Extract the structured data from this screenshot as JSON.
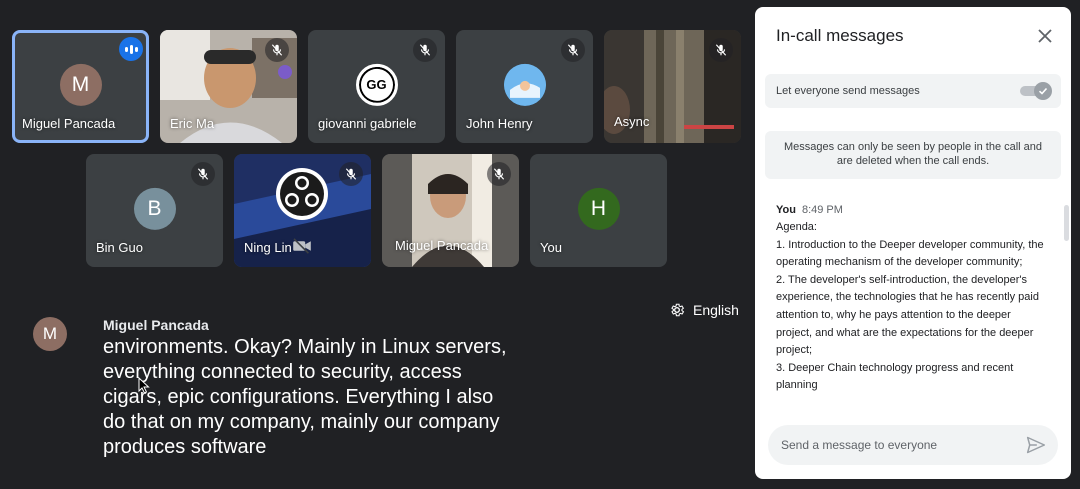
{
  "tiles": [
    {
      "name": "Miguel Pancada",
      "initial": "M",
      "avatar_color": "#8d6e63",
      "speaking": true
    },
    {
      "name": "Eric Ma",
      "muted": true
    },
    {
      "name": "giovanni gabriele",
      "initial": "GG",
      "muted": true
    },
    {
      "name": "John Henry",
      "muted": true
    },
    {
      "name": "Async",
      "muted": true
    },
    {
      "name": "Bin Guo",
      "initial": "B",
      "avatar_color": "#78909c",
      "muted": true
    },
    {
      "name": "Ning Lin",
      "muted": true,
      "camera_off": true
    },
    {
      "name": "Miguel Pancada",
      "muted": true
    },
    {
      "name": "You",
      "initial": "H",
      "avatar_color": "#33691e"
    }
  ],
  "captions": {
    "speaker_initial": "M",
    "speaker": "Miguel Pancada",
    "text": "environments. Okay? Mainly in Linux servers, everything connected to security, access cigars, epic configurations. Everything I also do that on my company, mainly our company produces software"
  },
  "language": {
    "label": "English"
  },
  "panel": {
    "title": "In-call messages",
    "toggle_label": "Let everyone send messages",
    "toggle_on": true,
    "notice": "Messages can only be seen by people in the call and are deleted when the call ends.",
    "message": {
      "sender": "You",
      "time": "8:49 PM",
      "lines": [
        "Agenda:",
        "1. Introduction to the Deeper developer community, the operating mechanism of the developer community;",
        "2. The developer's self-introduction, the developer's experience, the technologies that he has recently paid attention to, why he pays attention to the deeper project, and what are the expectations for the deeper project;",
        "3. Deeper Chain technology progress and recent planning"
      ]
    },
    "compose_placeholder": "Send a message to everyone"
  },
  "colors": {
    "accent": "#1a73e8",
    "active_outline": "#8ab4f8",
    "background": "#202124"
  }
}
